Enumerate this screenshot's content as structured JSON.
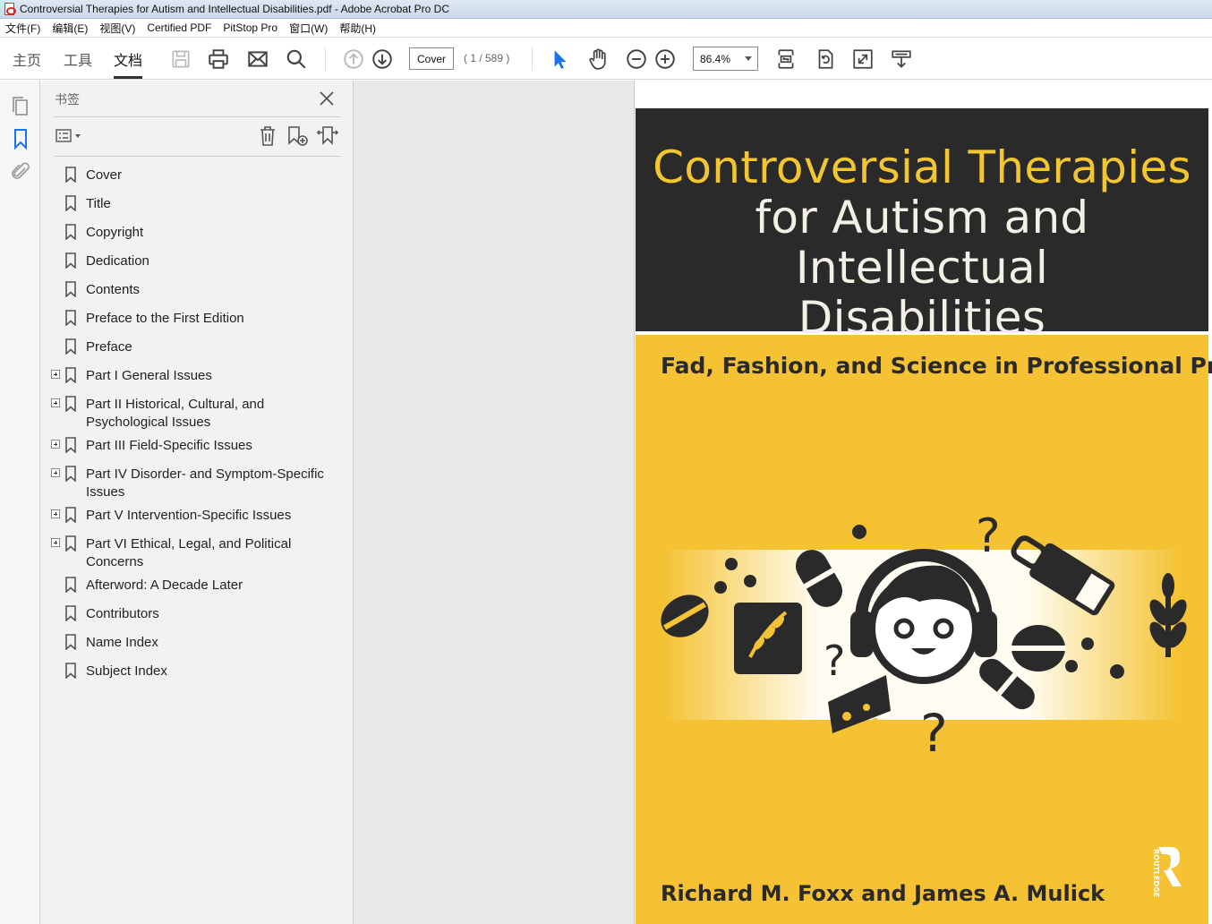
{
  "window": {
    "title": "Controversial Therapies for Autism and Intellectual Disabilities.pdf - Adobe Acrobat Pro DC"
  },
  "menubar": {
    "items": [
      "文件(F)",
      "编辑(E)",
      "视图(V)",
      "Certified PDF",
      "PitStop Pro",
      "窗口(W)",
      "帮助(H)"
    ]
  },
  "toolbar": {
    "tabs": [
      "主页",
      "工具",
      "文档"
    ],
    "active_tab": "文档",
    "page_field_value": "Cover",
    "page_count": "( 1 / 589 )",
    "zoom_value": "86.4%",
    "icons": [
      "save-icon",
      "print-icon",
      "email-icon",
      "search-icon",
      "prev-page-icon",
      "next-page-icon",
      "select-arrow-icon",
      "hand-icon",
      "zoom-out-icon",
      "zoom-in-icon",
      "fit-page-icon",
      "rotate-icon",
      "fullscreen-icon",
      "read-mode-icon"
    ],
    "accent_color": "#1a73e8"
  },
  "leftrail": {
    "icons": [
      "pages-icon",
      "bookmark-icon",
      "attachment-icon"
    ]
  },
  "bookmarks": {
    "title": "书签",
    "items": [
      {
        "label": "Cover",
        "expandable": false
      },
      {
        "label": "Title",
        "expandable": false
      },
      {
        "label": "Copyright",
        "expandable": false
      },
      {
        "label": "Dedication",
        "expandable": false
      },
      {
        "label": "Contents",
        "expandable": false
      },
      {
        "label": "Preface to the First Edition",
        "expandable": false
      },
      {
        "label": "Preface",
        "expandable": false
      },
      {
        "label": "Part I General Issues",
        "expandable": true
      },
      {
        "label": "Part II Historical, Cultural, and Psychological Issues",
        "expandable": true
      },
      {
        "label": "Part III Field-Specific Issues",
        "expandable": true
      },
      {
        "label": "Part IV Disorder- and Symptom-Specific Issues",
        "expandable": true
      },
      {
        "label": "Part V Intervention-Specific Issues",
        "expandable": true
      },
      {
        "label": "Part VI Ethical, Legal, and Political Concerns",
        "expandable": true
      },
      {
        "label": "Afterword: A Decade Later",
        "expandable": false
      },
      {
        "label": "Contributors",
        "expandable": false
      },
      {
        "label": "Name Index",
        "expandable": false
      },
      {
        "label": "Subject Index",
        "expandable": false
      }
    ]
  },
  "cover": {
    "title_line1": "Controversial Therapies",
    "title_line2": "for Autism and Intellectual",
    "title_line3": "Disabilities",
    "subtitle": "Fad, Fashion, and Science in Professional Practice",
    "authors": "Richard M. Foxx and James A. Mulick",
    "publisher": "ROUTLEDGE",
    "colors": {
      "dark": "#2b2a2a",
      "yellow": "#f4c232",
      "title_accent": "#f3c630"
    }
  }
}
